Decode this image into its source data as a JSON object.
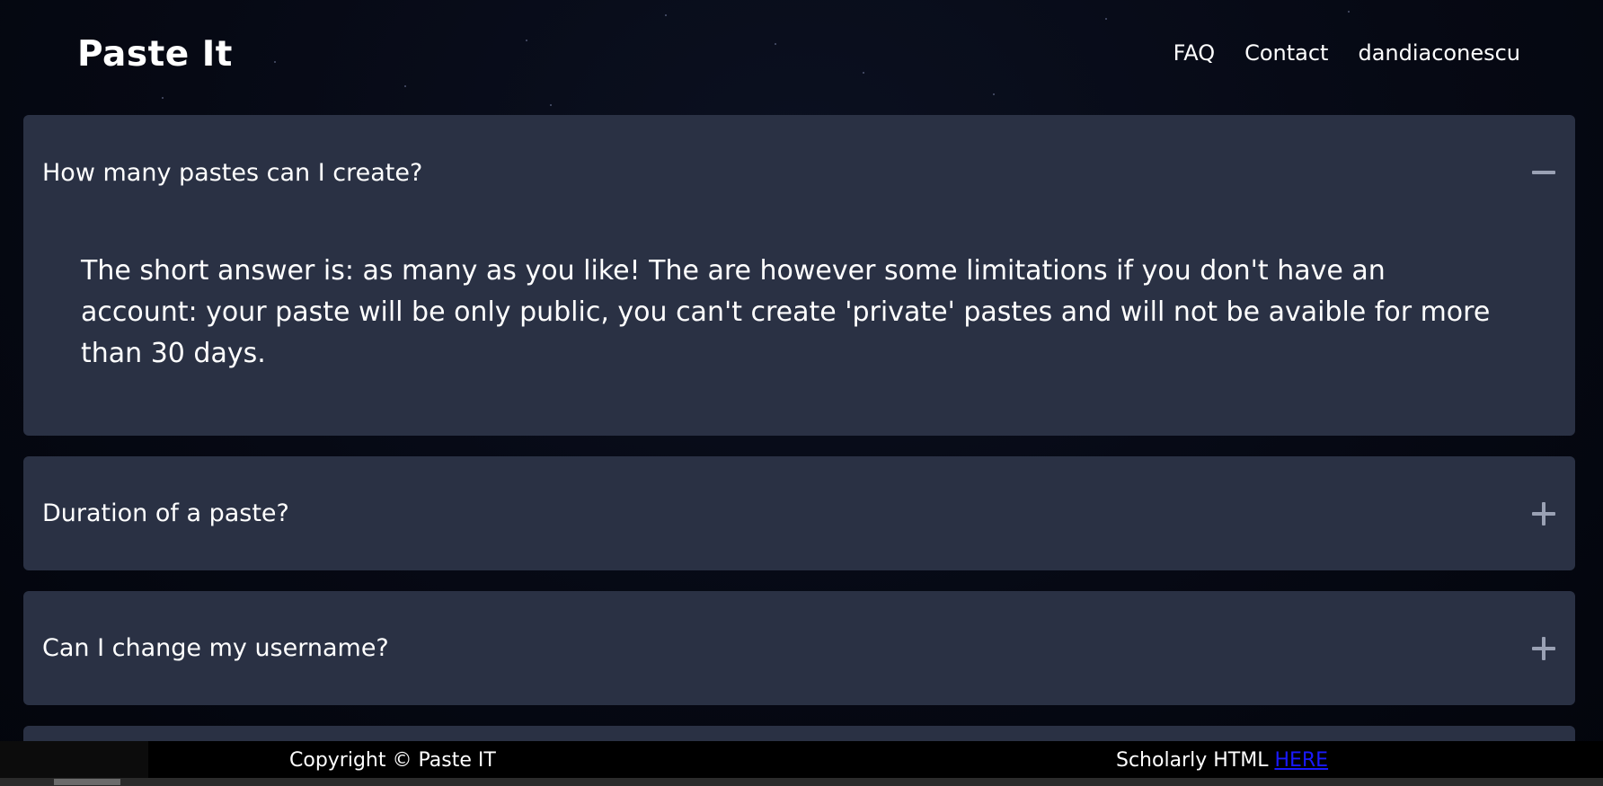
{
  "header": {
    "brand": "Paste It",
    "nav": [
      {
        "label": "FAQ"
      },
      {
        "label": "Contact"
      },
      {
        "label": "dandiaconescu"
      }
    ]
  },
  "faq": [
    {
      "question": "How many pastes can I create?",
      "expanded": true,
      "toggle_icon": "minus-icon",
      "answer": "The short answer is: as many as you like! The are however some limitations if you don't have an account: your paste will be only public, you can't create 'private' pastes and will not be avaible for more than 30 days."
    },
    {
      "question": "Duration of a paste?",
      "expanded": false,
      "toggle_icon": "plus-icon"
    },
    {
      "question": "Can I change my username?",
      "expanded": false,
      "toggle_icon": "plus-icon"
    }
  ],
  "footer": {
    "copyright": "Copyright © Paste IT",
    "scholarly_text": "Scholarly HTML ",
    "scholarly_link": "HERE"
  },
  "colors": {
    "card": "#2a3144",
    "background": "#05070f",
    "toggle": "#9aa1b4",
    "link": "#1a1aff"
  }
}
